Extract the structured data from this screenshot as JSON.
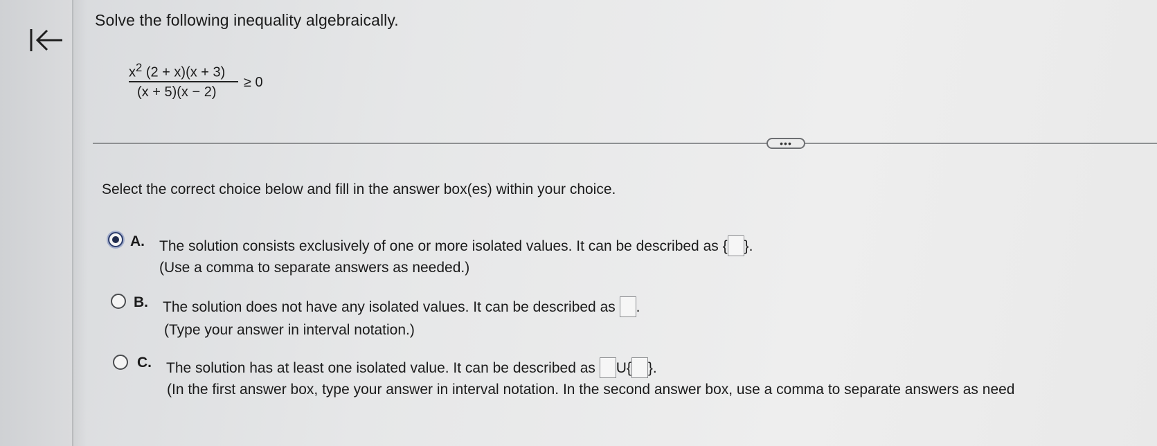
{
  "nav": {
    "back_icon": "first-page-arrow-icon"
  },
  "question": {
    "prompt": "Solve the following inequality algebraically.",
    "numerator_base": "x",
    "numerator_exponent": "2",
    "numerator_rest": "(2 + x)(x + 3)",
    "denominator": "(x + 5)(x − 2)",
    "relation": "≥ 0"
  },
  "more_button": {
    "label": "•••"
  },
  "instruction": "Select the correct choice below and fill in the answer box(es) within your choice.",
  "choices": [
    {
      "letter": "A.",
      "selected": true,
      "line1_before": "The solution consists exclusively of one or more isolated values. It can be described as ",
      "brace_open": "{",
      "brace_close": "}.",
      "line2": "(Use a comma to separate answers as needed.)"
    },
    {
      "letter": "B.",
      "selected": false,
      "line1_before": "The solution does not have any isolated values. It can be described as ",
      "period": ".",
      "line2": "(Type your answer in interval notation.)"
    },
    {
      "letter": "C.",
      "selected": false,
      "line1_before": "The solution has at least one isolated value. It can be described as ",
      "union": "U{",
      "brace_close": "}.",
      "line2": "(In the first answer box, type your answer in interval notation. In the second answer box, use a comma to separate answers as need"
    }
  ]
}
